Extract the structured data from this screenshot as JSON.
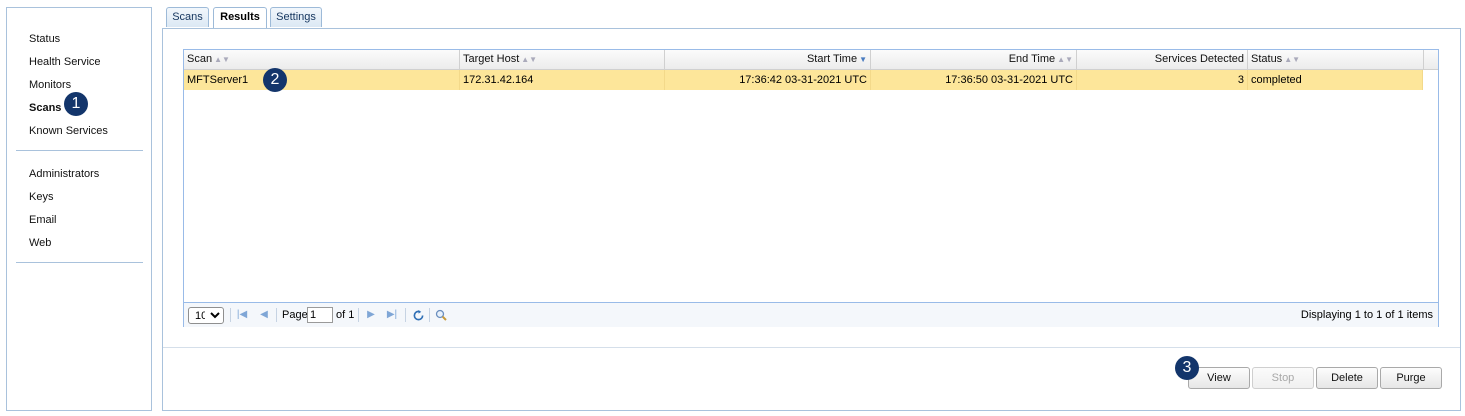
{
  "sidebar": {
    "group1": [
      "Status",
      "Health Service",
      "Monitors",
      "Scans",
      "Known Services"
    ],
    "group2": [
      "Administrators",
      "Keys",
      "Email",
      "Web"
    ],
    "active": "Scans"
  },
  "tabs": [
    "Scans",
    "Results",
    "Settings"
  ],
  "active_tab": "Results",
  "badges": [
    "1",
    "2",
    "3"
  ],
  "grid": {
    "columns": [
      "Scan",
      "Target Host",
      "Start Time",
      "End Time",
      "Services Detected",
      "Status"
    ],
    "sorted_column": "Start Time",
    "sort_direction": "descending",
    "rows": [
      {
        "scan": "MFTServer1",
        "target_host": "172.31.42.164",
        "start_time": "17:36:42 03-31-2021 UTC",
        "end_time": "17:36:50 03-31-2021 UTC",
        "services_detected": "3",
        "status": "completed"
      }
    ],
    "selected_row_color": "#fde69a"
  },
  "pager": {
    "page_size": "10",
    "page_label": "Page",
    "page_value": "1",
    "of_label": "of 1",
    "summary": "Displaying 1 to 1 of 1 items"
  },
  "actions": {
    "view": "View",
    "stop": "Stop",
    "delete": "Delete",
    "purge": "Purge"
  },
  "colors": {
    "accent_border": "#a9c2dc",
    "badge": "#13356b"
  }
}
